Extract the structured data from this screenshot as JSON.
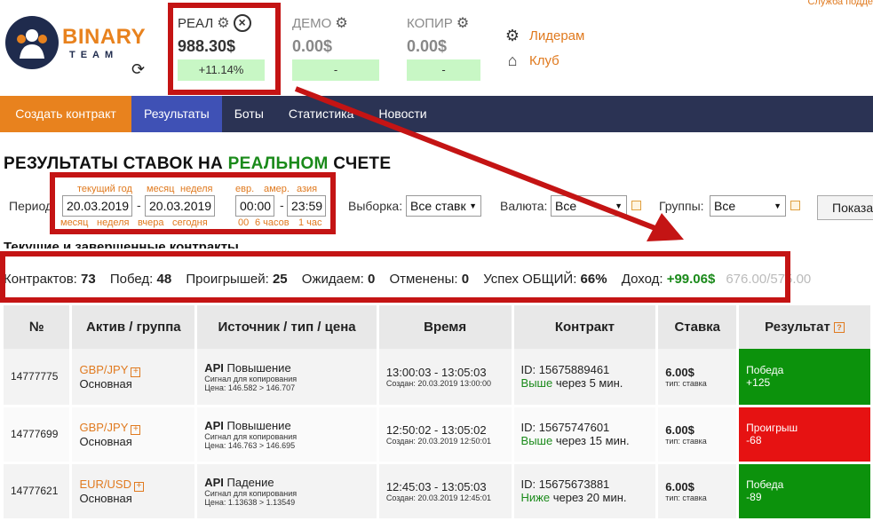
{
  "support_link": "Служба подде",
  "logo": {
    "name": "BINARY",
    "sub": "TEAM"
  },
  "accounts": [
    {
      "name": "РЕАЛ",
      "value": "988.30$",
      "change": "+11.14%"
    },
    {
      "name": "ДЕМО",
      "value": "0.00$",
      "change": "-"
    },
    {
      "name": "КОПИР",
      "value": "0.00$",
      "change": "-"
    }
  ],
  "side_links": {
    "leaders": "Лидерам",
    "club": "Клуб"
  },
  "nav": {
    "create": "Создать контракт",
    "results": "Результаты",
    "bots": "Боты",
    "stats": "Статистика",
    "news": "Новости"
  },
  "title": {
    "part1": "РЕЗУЛЬТАТЫ СТАВОК НА ",
    "part2": "РЕАЛЬНОМ",
    "part3": " СЧЕТЕ"
  },
  "filters": {
    "period_label": "Период:",
    "hints_top": {
      "cur_year": "текущий год",
      "month": "месяц",
      "week": "неделя",
      "eur": "евр.",
      "amer": "амер.",
      "asia": "азия"
    },
    "hints_bottom": {
      "month": "месяц",
      "week": "неделя",
      "yesterday": "вчера",
      "today": "сегодня",
      "h00": "00",
      "h6": "6 часов",
      "h1": "1 час"
    },
    "date_from": "20.03.2019",
    "date_to": "20.03.2019",
    "time_from": "00:00",
    "time_to": "23:59",
    "dash": "-",
    "selection_label": "Выборка:",
    "selection_value": "Все ставк",
    "currency_label": "Валюта:",
    "currency_value": "Все",
    "groups_label": "Группы:",
    "groups_value": "Все",
    "show_button": "Показа"
  },
  "section_heading": "Текущие и завершенные контракты",
  "stats": {
    "contracts_label": "Контрактов:",
    "contracts": "73",
    "wins_label": "Побед:",
    "wins": "48",
    "losses_label": "Проигрышей:",
    "losses": "25",
    "pending_label": "Ожидаем:",
    "pending": "0",
    "cancelled_label": "Отменены:",
    "cancelled": "0",
    "success_label": "Успех ОБЩИЙ:",
    "success": "66%",
    "income_label": "Доход:",
    "income": "+99.06$",
    "totals": "676.00/575.00"
  },
  "table": {
    "headers": [
      "№",
      "Актив / группа",
      "Источник / тип / цена",
      "Время",
      "Контракт",
      "Ставка",
      "Результат"
    ],
    "rows": [
      {
        "id": "14777775",
        "pair": "GBP/JPY",
        "group": "Основная",
        "src": "API",
        "dir": "Повышение",
        "signal": "Сигнал для копирования",
        "price": "Цена: 146.582 > 146.707",
        "time": "13:00:03 - 13:05:03",
        "created": "Создан: 20.03.2019 13:00:00",
        "cid": "ID: 15675889461",
        "cdir": "Выше",
        "cdur": " через 5 мин.",
        "stake": "6.00$",
        "stype": "тип: ставка",
        "result": "Победа",
        "amount": "+125"
      },
      {
        "id": "14777699",
        "pair": "GBP/JPY",
        "group": "Основная",
        "src": "API",
        "dir": "Повышение",
        "signal": "Сигнал для копирования",
        "price": "Цена: 146.763 > 146.695",
        "time": "12:50:02 - 13:05:02",
        "created": "Создан: 20.03.2019 12:50:01",
        "cid": "ID: 15675747601",
        "cdir": "Выше",
        "cdur": " через 15 мин.",
        "stake": "6.00$",
        "stype": "тип: ставка",
        "result": "Проигрыш",
        "amount": "-68"
      },
      {
        "id": "14777621",
        "pair": "EUR/USD",
        "group": "Основная",
        "src": "API",
        "dir": "Падение",
        "signal": "Сигнал для копирования",
        "price": "Цена: 1.13638 > 1.13549",
        "time": "12:45:03 - 13:05:03",
        "created": "Создан: 20.03.2019 12:45:01",
        "cid": "ID: 15675673881",
        "cdir": "Ниже",
        "cdur": " через 20 мин.",
        "stake": "6.00$",
        "stype": "тип: ставка",
        "result": "Победа",
        "amount": "-89"
      }
    ]
  },
  "colors": {
    "accent": "#e8821e",
    "nav": "#2b3354",
    "active": "#3f51b5",
    "win": "#0c920c",
    "lose": "#e61212",
    "annotation": "#c41414"
  }
}
